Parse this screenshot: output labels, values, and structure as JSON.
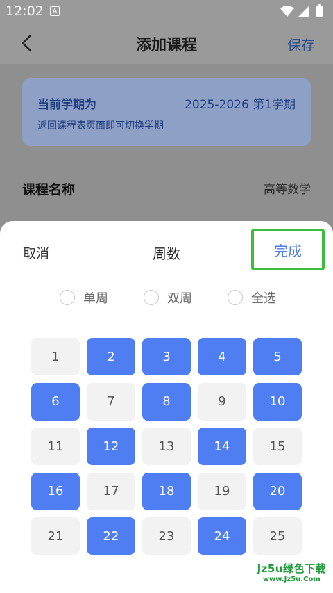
{
  "status_bar": {
    "time": "12:02",
    "notice_letter": "A"
  },
  "header": {
    "title": "添加课程",
    "save_label": "保存"
  },
  "semester": {
    "label": "当前学期为",
    "value": "2025-2026  第1学期",
    "hint": "返回课程表页面即可切换学期"
  },
  "course": {
    "label": "课程名称",
    "value": "高等数学"
  },
  "sheet": {
    "cancel_label": "取消",
    "title": "周数",
    "done_label": "完成",
    "options": [
      {
        "label": "单周",
        "checked": false
      },
      {
        "label": "双周",
        "checked": false
      },
      {
        "label": "全选",
        "checked": false
      }
    ],
    "weeks": [
      {
        "number": "1",
        "selected": false
      },
      {
        "number": "2",
        "selected": true
      },
      {
        "number": "3",
        "selected": true
      },
      {
        "number": "4",
        "selected": true
      },
      {
        "number": "5",
        "selected": true
      },
      {
        "number": "6",
        "selected": true
      },
      {
        "number": "7",
        "selected": false
      },
      {
        "number": "8",
        "selected": true
      },
      {
        "number": "9",
        "selected": false
      },
      {
        "number": "10",
        "selected": true
      },
      {
        "number": "11",
        "selected": false
      },
      {
        "number": "12",
        "selected": true
      },
      {
        "number": "13",
        "selected": false
      },
      {
        "number": "14",
        "selected": true
      },
      {
        "number": "15",
        "selected": false
      },
      {
        "number": "16",
        "selected": true
      },
      {
        "number": "17",
        "selected": false
      },
      {
        "number": "18",
        "selected": true
      },
      {
        "number": "19",
        "selected": false
      },
      {
        "number": "20",
        "selected": true
      },
      {
        "number": "21",
        "selected": false
      },
      {
        "number": "22",
        "selected": true
      },
      {
        "number": "23",
        "selected": false
      },
      {
        "number": "24",
        "selected": true
      },
      {
        "number": "25",
        "selected": false
      }
    ]
  },
  "watermark": {
    "main": "Jz5u绿色下载",
    "sub": "www.Jz5u.Com"
  },
  "colors": {
    "selected": "#4f7ef2",
    "unselected": "#f2f2f2",
    "highlight": "#3cbe3c",
    "accent": "#4d7de8"
  }
}
